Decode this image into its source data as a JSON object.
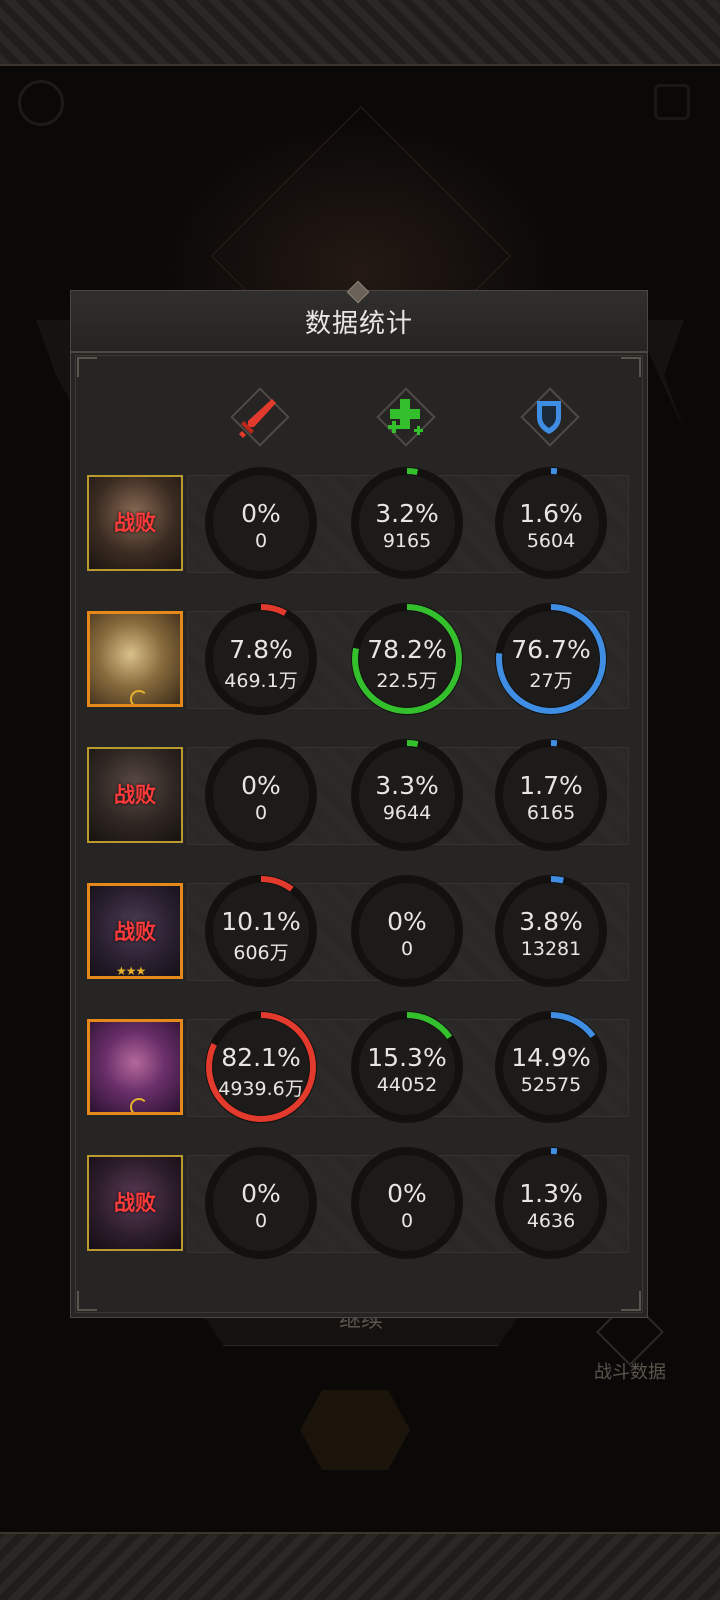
{
  "panel": {
    "title": "数据统计"
  },
  "columns": [
    {
      "icon": "sword-damage-icon",
      "color": "#e23a2c"
    },
    {
      "icon": "heal-plus-icon",
      "color": "#34c02c"
    },
    {
      "icon": "shield-defense-icon",
      "color": "#3f8ee3"
    }
  ],
  "heroes": [
    {
      "status": "战败",
      "alive": false,
      "badge": "",
      "stats": [
        {
          "pct": "0%",
          "fraction": 0,
          "value": "0"
        },
        {
          "pct": "3.2%",
          "fraction": 0.032,
          "value": "9165"
        },
        {
          "pct": "1.6%",
          "fraction": 0.016,
          "value": "5604"
        }
      ]
    },
    {
      "status": "",
      "alive": true,
      "badge": "moon",
      "stats": [
        {
          "pct": "7.8%",
          "fraction": 0.078,
          "value": "469.1万"
        },
        {
          "pct": "78.2%",
          "fraction": 0.782,
          "value": "22.5万"
        },
        {
          "pct": "76.7%",
          "fraction": 0.767,
          "value": "27万"
        }
      ]
    },
    {
      "status": "战败",
      "alive": false,
      "badge": "",
      "stats": [
        {
          "pct": "0%",
          "fraction": 0,
          "value": "0"
        },
        {
          "pct": "3.3%",
          "fraction": 0.033,
          "value": "9644"
        },
        {
          "pct": "1.7%",
          "fraction": 0.017,
          "value": "6165"
        }
      ]
    },
    {
      "status": "战败",
      "alive": true,
      "badge": "stars",
      "stats": [
        {
          "pct": "10.1%",
          "fraction": 0.101,
          "value": "606万"
        },
        {
          "pct": "0%",
          "fraction": 0,
          "value": "0"
        },
        {
          "pct": "3.8%",
          "fraction": 0.038,
          "value": "13281"
        }
      ]
    },
    {
      "status": "",
      "alive": true,
      "badge": "moon",
      "stats": [
        {
          "pct": "82.1%",
          "fraction": 0.821,
          "value": "4939.6万"
        },
        {
          "pct": "15.3%",
          "fraction": 0.153,
          "value": "44052"
        },
        {
          "pct": "14.9%",
          "fraction": 0.149,
          "value": "52575"
        }
      ]
    },
    {
      "status": "战败",
      "alive": false,
      "badge": "",
      "stats": [
        {
          "pct": "0%",
          "fraction": 0,
          "value": "0"
        },
        {
          "pct": "0%",
          "fraction": 0,
          "value": "0"
        },
        {
          "pct": "1.3%",
          "fraction": 0.013,
          "value": "4636"
        }
      ]
    }
  ],
  "buttons": {
    "continue": "继续",
    "battle_data": "战斗数据"
  }
}
